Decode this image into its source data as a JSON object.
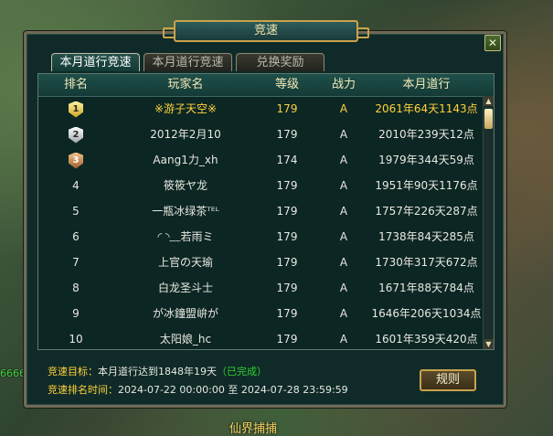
{
  "window": {
    "title": "竞速",
    "close_label": "✕"
  },
  "tabs": [
    {
      "label": "本月道行竞速",
      "active": true
    },
    {
      "label": "本月道行竞速",
      "active": false
    },
    {
      "label": "兑换奖励",
      "active": false
    }
  ],
  "table": {
    "columns": {
      "rank": "排名",
      "name": "玩家名",
      "level": "等级",
      "power": "战力",
      "month": "本月道行"
    },
    "rows": [
      {
        "rank": "1",
        "medal": true,
        "name": "※游子天空※",
        "level": "179",
        "power": "A",
        "month": "2061年64天1143点",
        "highlight": true
      },
      {
        "rank": "2",
        "medal": true,
        "name": "2012年2月10",
        "level": "179",
        "power": "A",
        "month": "2010年239天12点"
      },
      {
        "rank": "3",
        "medal": true,
        "name": "Aang1力_xh",
        "level": "174",
        "power": "A",
        "month": "1979年344天59点"
      },
      {
        "rank": "4",
        "name": "筱筱ヤ龙",
        "level": "179",
        "power": "A",
        "month": "1951年90天1176点"
      },
      {
        "rank": "5",
        "name": "一瓶冰绿茶ᵀᴱᴸ",
        "level": "179",
        "power": "A",
        "month": "1757年226天287点"
      },
      {
        "rank": "6",
        "name": "◜ ◝﹏若雨ミ",
        "level": "179",
        "power": "A",
        "month": "1738年84天285点"
      },
      {
        "rank": "7",
        "name": "上官の天瑜",
        "level": "179",
        "power": "A",
        "month": "1730年317天672点"
      },
      {
        "rank": "8",
        "name": "白龙圣斗士",
        "level": "179",
        "power": "A",
        "month": "1671年88天784点"
      },
      {
        "rank": "9",
        "name": "が冰鐘盟峅が",
        "level": "179",
        "power": "A",
        "month": "1646年206天1034点"
      },
      {
        "rank": "10",
        "name": "太阳娘_hc",
        "level": "179",
        "power": "A",
        "month": "1601年359天420点"
      }
    ]
  },
  "footer": {
    "goal_label": "竞速目标：",
    "goal_value": "本月道行达到1848年19天",
    "goal_status": "（已完成）",
    "time_label": "竞速排名时间：",
    "time_value": "2024-07-22 00:00:00 至 2024-07-28 23:59:59"
  },
  "rules_button": "规则",
  "background": {
    "caption": "仙界捕捕",
    "left_number": "6666"
  },
  "colors": {
    "gold_text": "#ffd23a",
    "completed": "#32d232",
    "panel_bg": "#0c2624"
  }
}
